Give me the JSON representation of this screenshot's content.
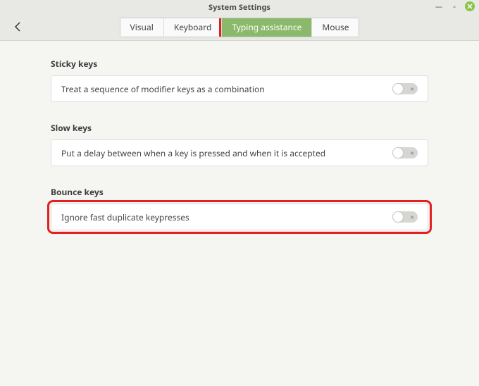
{
  "window": {
    "title": "System Settings"
  },
  "tabs": {
    "visual": "Visual",
    "keyboard": "Keyboard",
    "typing_assistance": "Typing assistance",
    "mouse": "Mouse"
  },
  "sections": {
    "sticky": {
      "label": "Sticky keys",
      "desc": "Treat a sequence of modifier keys as a combination"
    },
    "slow": {
      "label": "Slow keys",
      "desc": "Put a delay between when a key is pressed and when it is accepted"
    },
    "bounce": {
      "label": "Bounce keys",
      "desc": "Ignore fast duplicate keypresses"
    }
  }
}
